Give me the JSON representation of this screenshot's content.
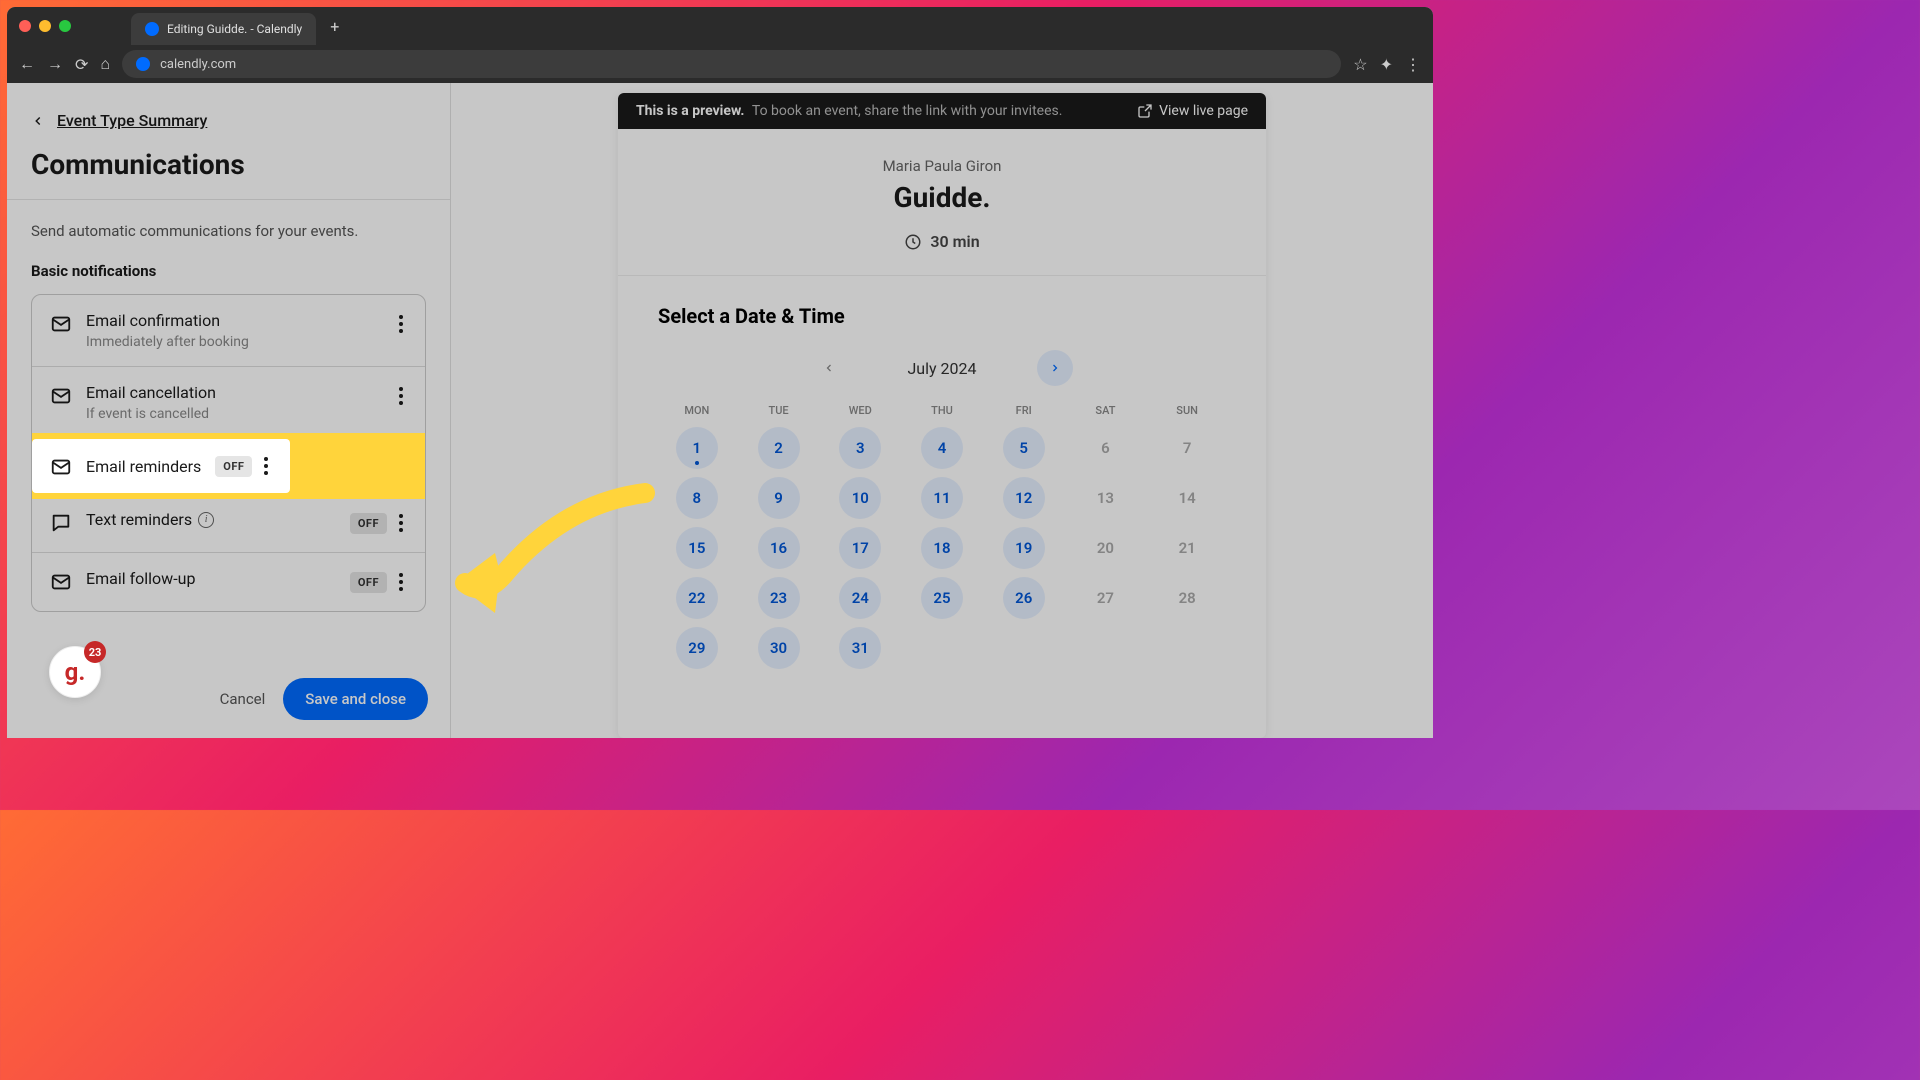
{
  "browser": {
    "tab_title": "Editing Guidde. - Calendly",
    "url": "calendly.com"
  },
  "sidebar": {
    "back_label": "Event Type Summary",
    "title": "Communications",
    "description": "Send automatic communications for your events.",
    "section_label": "Basic notifications",
    "items": [
      {
        "title": "Email confirmation",
        "subtitle": "Immediately after booking",
        "icon": "mail",
        "off": false
      },
      {
        "title": "Email cancellation",
        "subtitle": "If event is cancelled",
        "icon": "mail",
        "off": false
      },
      {
        "title": "Email reminders",
        "subtitle": "",
        "icon": "mail",
        "off": true,
        "highlighted": true
      },
      {
        "title": "Text reminders",
        "subtitle": "",
        "icon": "chat",
        "off": true,
        "info": true
      },
      {
        "title": "Email follow-up",
        "subtitle": "",
        "icon": "mail",
        "off": true
      }
    ],
    "off_label": "OFF",
    "cancel_label": "Cancel",
    "save_label": "Save and close"
  },
  "preview": {
    "banner_bold": "This is a preview.",
    "banner_text": "To book an event, share the link with your invitees.",
    "view_live": "View live page",
    "host": "Maria Paula Giron",
    "event_title": "Guidde.",
    "duration": "30 min",
    "select_label": "Select a Date & Time",
    "month": "July 2024",
    "dow": [
      "MON",
      "TUE",
      "WED",
      "THU",
      "FRI",
      "SAT",
      "SUN"
    ],
    "days": [
      {
        "n": "1",
        "a": true,
        "today": true
      },
      {
        "n": "2",
        "a": true
      },
      {
        "n": "3",
        "a": true
      },
      {
        "n": "4",
        "a": true
      },
      {
        "n": "5",
        "a": true
      },
      {
        "n": "6",
        "a": false
      },
      {
        "n": "7",
        "a": false
      },
      {
        "n": "8",
        "a": true
      },
      {
        "n": "9",
        "a": true
      },
      {
        "n": "10",
        "a": true
      },
      {
        "n": "11",
        "a": true
      },
      {
        "n": "12",
        "a": true
      },
      {
        "n": "13",
        "a": false
      },
      {
        "n": "14",
        "a": false
      },
      {
        "n": "15",
        "a": true
      },
      {
        "n": "16",
        "a": true
      },
      {
        "n": "17",
        "a": true
      },
      {
        "n": "18",
        "a": true
      },
      {
        "n": "19",
        "a": true
      },
      {
        "n": "20",
        "a": false
      },
      {
        "n": "21",
        "a": false
      },
      {
        "n": "22",
        "a": true
      },
      {
        "n": "23",
        "a": true
      },
      {
        "n": "24",
        "a": true
      },
      {
        "n": "25",
        "a": true
      },
      {
        "n": "26",
        "a": true
      },
      {
        "n": "27",
        "a": false
      },
      {
        "n": "28",
        "a": false
      },
      {
        "n": "29",
        "a": true
      },
      {
        "n": "30",
        "a": true
      },
      {
        "n": "31",
        "a": true
      }
    ]
  },
  "guidde": {
    "count": "23",
    "letter": "g."
  }
}
